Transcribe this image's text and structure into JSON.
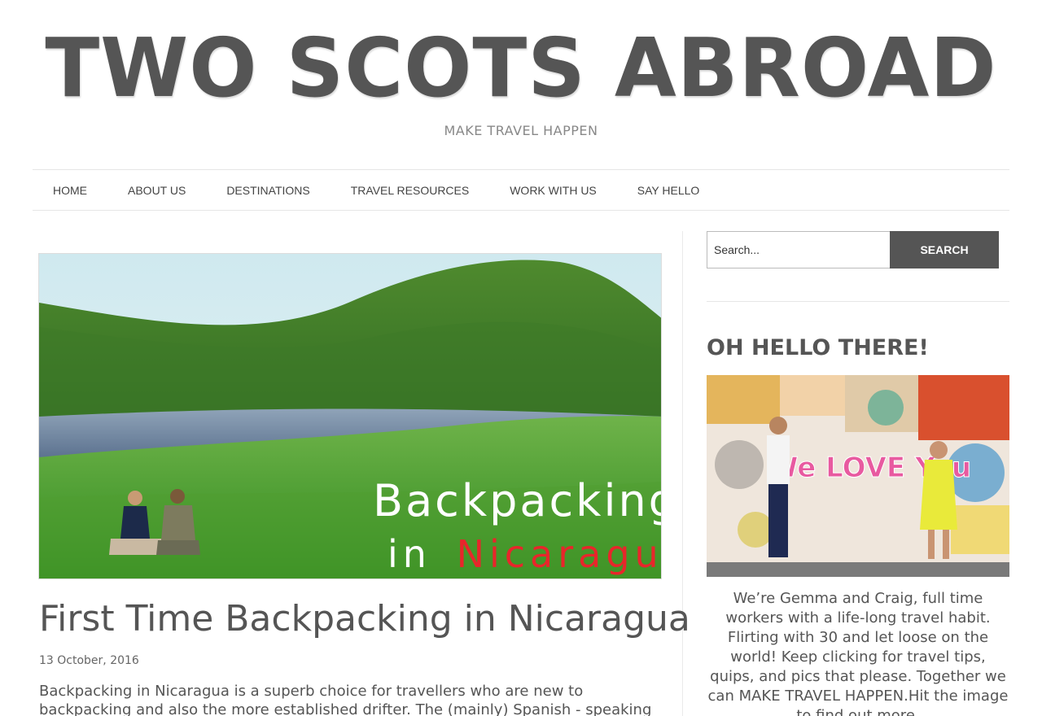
{
  "header": {
    "title": "TWO SCOTS ABROAD",
    "tagline": "MAKE TRAVEL HAPPEN"
  },
  "nav": {
    "items": [
      {
        "label": "HOME"
      },
      {
        "label": "ABOUT US"
      },
      {
        "label": "DESTINATIONS"
      },
      {
        "label": "TRAVEL RESOURCES"
      },
      {
        "label": "WORK WITH US"
      },
      {
        "label": "SAY HELLO"
      }
    ]
  },
  "post": {
    "image_text_line1": "Backpacking",
    "image_text_line2_prefix": "in",
    "image_text_line2_highlight": "Nicaragua",
    "title": "First Time Backpacking in Nicaragua",
    "date": "13 October, 2016",
    "excerpt": "Backpacking in Nicaragua is a superb choice for travellers who are new to backpacking and also the more established drifter.  The (mainly) Spanish - speaking Central American"
  },
  "sidebar": {
    "search": {
      "placeholder": "Search...",
      "button_label": "SEARCH"
    },
    "widget_title": "OH HELLO THERE!",
    "about_text": "We’re Gemma and Craig, full time workers with a life-long travel habit. Flirting with 30 and let loose on the world! Keep clicking for travel tips, quips, and pics that please. Together we can MAKE TRAVEL HAPPEN.Hit the image to find out more.",
    "photo_graffiti_text": "We LOVE You"
  },
  "colors": {
    "text": "#555555",
    "button_bg": "#555555",
    "accent_red": "#e8262b"
  }
}
